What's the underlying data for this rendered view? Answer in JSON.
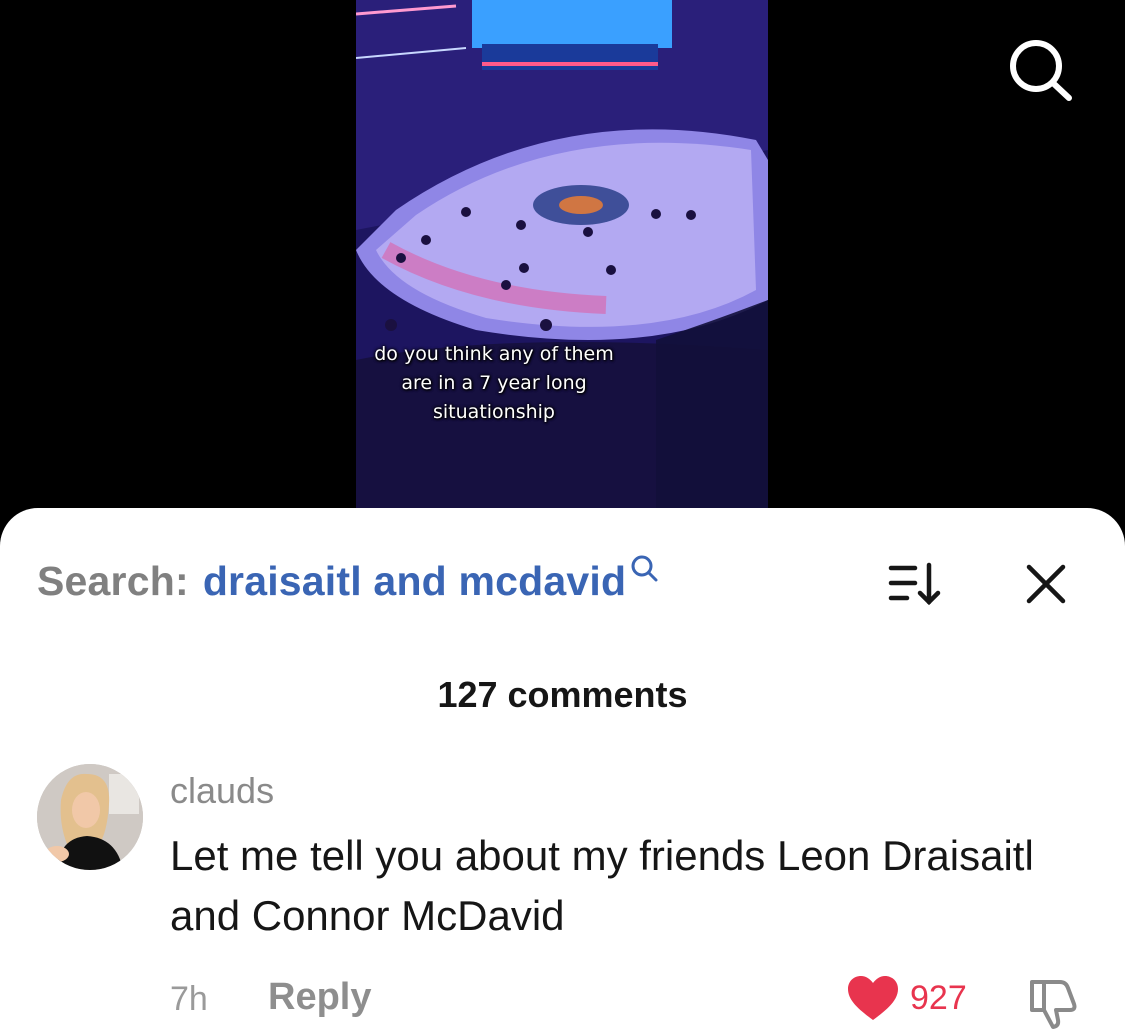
{
  "video": {
    "caption": "do you think any of them\nare in a 7 year long\nsituationship",
    "search_icon": "search-icon"
  },
  "comments_sheet": {
    "search_prefix": "Search:",
    "search_query": "draisaitl and mcdavid",
    "search_mini_icon": "search-icon",
    "sort_icon": "sort-icon",
    "close_icon": "close-icon",
    "comment_count": "127 comments",
    "comments": [
      {
        "username": "clauds",
        "text": "Let me tell you about my friends Leon Draisaitl and Connor McDavid",
        "time": "7h",
        "reply_label": "Reply",
        "like_count": "927",
        "liked": true,
        "like_icon": "heart-icon",
        "dislike_icon": "thumbs-down-icon"
      }
    ]
  },
  "colors": {
    "query_blue": "#3a65b4",
    "like_red": "#e8344e",
    "muted_gray": "#8a8a8a"
  }
}
